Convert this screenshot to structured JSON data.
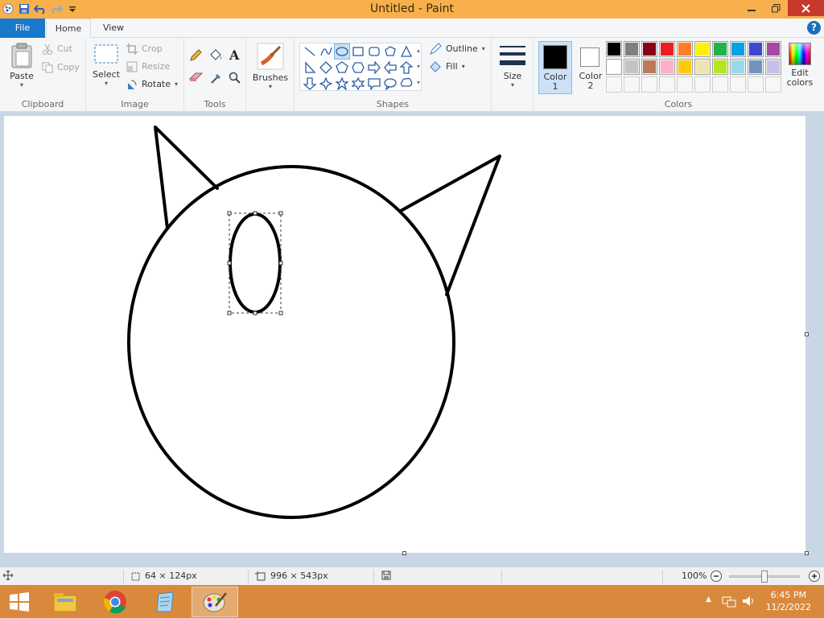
{
  "window": {
    "title": "Untitled - Paint"
  },
  "tabs": {
    "file": "File",
    "home": "Home",
    "view": "View"
  },
  "help_label": "?",
  "clipboard": {
    "paste": "Paste",
    "cut": "Cut",
    "copy": "Copy",
    "group": "Clipboard"
  },
  "image": {
    "select": "Select",
    "crop": "Crop",
    "resize": "Resize",
    "rotate": "Rotate",
    "group": "Image"
  },
  "tools": {
    "group": "Tools",
    "text_tool": "A"
  },
  "brushes": {
    "label": "Brushes"
  },
  "shapes": {
    "outline": "Outline",
    "fill": "Fill",
    "group": "Shapes",
    "selected": "oval"
  },
  "size": {
    "label": "Size"
  },
  "color1": {
    "line1": "Color",
    "line2": "1",
    "color": "#000000"
  },
  "color2": {
    "line1": "Color",
    "line2": "2",
    "color": "#ffffff"
  },
  "colors": {
    "group": "Colors",
    "edit_line1": "Edit",
    "edit_line2": "colors",
    "row1": [
      "#000000",
      "#7f7f7f",
      "#880015",
      "#ed1c24",
      "#ff7f27",
      "#fff200",
      "#22b14c",
      "#00a2e8",
      "#3f48cc",
      "#a349a4"
    ],
    "row2": [
      "#ffffff",
      "#c3c3c3",
      "#b97a57",
      "#ffaec9",
      "#ffc90e",
      "#efe4b0",
      "#b5e61d",
      "#99d9ea",
      "#7092be",
      "#c8bfe7"
    ]
  },
  "status": {
    "selection_size": "64 × 124px",
    "canvas_size": "996 × 543px",
    "zoom": "100%"
  },
  "taskbar": {
    "time": "6:45 PM",
    "date": "11/2/2022",
    "apps": [
      "file-explorer",
      "chrome",
      "notepad",
      "paint"
    ]
  }
}
